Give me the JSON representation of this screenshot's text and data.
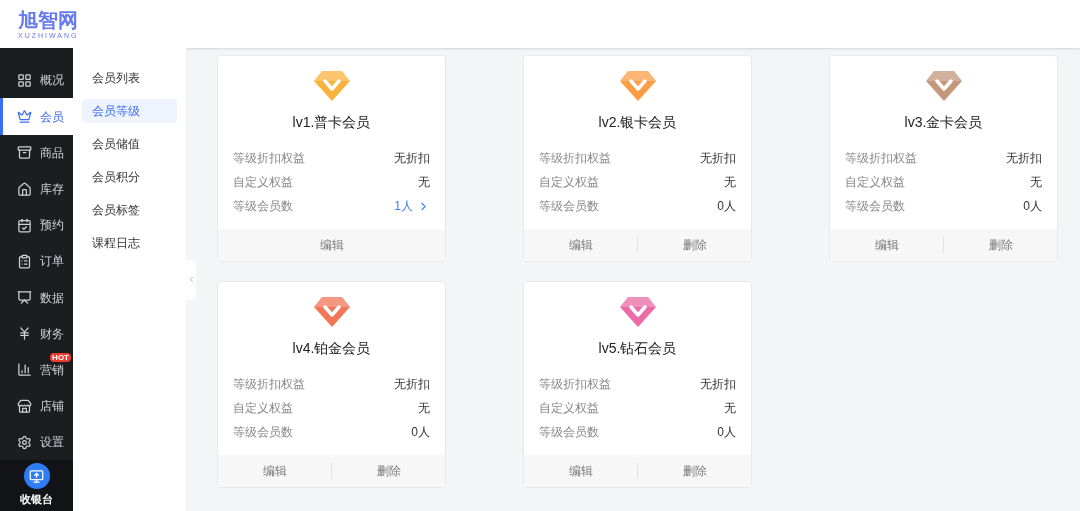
{
  "logo": {
    "title": "旭智网",
    "subtitle": "XUZHIWANG"
  },
  "nav": [
    {
      "label": "概况",
      "selected": false
    },
    {
      "label": "会员",
      "selected": true
    },
    {
      "label": "商品",
      "selected": false
    },
    {
      "label": "库存",
      "selected": false
    },
    {
      "label": "预约",
      "selected": false
    },
    {
      "label": "订单",
      "selected": false
    },
    {
      "label": "数据",
      "selected": false
    },
    {
      "label": "财务",
      "selected": false
    },
    {
      "label": "营销",
      "selected": false,
      "badge": "HOT"
    },
    {
      "label": "店铺",
      "selected": false
    },
    {
      "label": "设置",
      "selected": false
    }
  ],
  "cashier": {
    "label": "收银台"
  },
  "submenu": [
    {
      "label": "会员列表",
      "selected": false
    },
    {
      "label": "会员等级",
      "selected": true
    },
    {
      "label": "会员储值",
      "selected": false
    },
    {
      "label": "会员积分",
      "selected": false
    },
    {
      "label": "会员标签",
      "selected": false
    },
    {
      "label": "课程日志",
      "selected": false
    }
  ],
  "levels": [
    {
      "title": "lv1.普卡会员",
      "color": "#f9b23d",
      "rows": [
        {
          "label": "等级折扣权益",
          "value": "无折扣"
        },
        {
          "label": "自定义权益",
          "value": "无"
        },
        {
          "label": "等级会员数",
          "value": "1人",
          "link": true
        }
      ],
      "buttons": [
        "编辑"
      ]
    },
    {
      "title": "lv2.银卡会员",
      "color": "#fb9d45",
      "rows": [
        {
          "label": "等级折扣权益",
          "value": "无折扣"
        },
        {
          "label": "自定义权益",
          "value": "无"
        },
        {
          "label": "等级会员数",
          "value": "0人",
          "link": false
        }
      ],
      "buttons": [
        "编辑",
        "删除"
      ]
    },
    {
      "title": "lv3.金卡会员",
      "color": "#c3977b",
      "rows": [
        {
          "label": "等级折扣权益",
          "value": "无折扣"
        },
        {
          "label": "自定义权益",
          "value": "无"
        },
        {
          "label": "等级会员数",
          "value": "0人",
          "link": false
        }
      ],
      "buttons": [
        "编辑",
        "删除"
      ]
    },
    {
      "title": "lv4.铂金会员",
      "color": "#f27657",
      "rows": [
        {
          "label": "等级折扣权益",
          "value": "无折扣"
        },
        {
          "label": "自定义权益",
          "value": "无"
        },
        {
          "label": "等级会员数",
          "value": "0人",
          "link": false
        }
      ],
      "buttons": [
        "编辑",
        "删除"
      ]
    },
    {
      "title": "lv5.钻石会员",
      "color": "#ec6aa5",
      "rows": [
        {
          "label": "等级折扣权益",
          "value": "无折扣"
        },
        {
          "label": "自定义权益",
          "value": "无"
        },
        {
          "label": "等级会员数",
          "value": "0人",
          "link": false
        }
      ],
      "buttons": [
        "编辑",
        "删除"
      ]
    }
  ]
}
